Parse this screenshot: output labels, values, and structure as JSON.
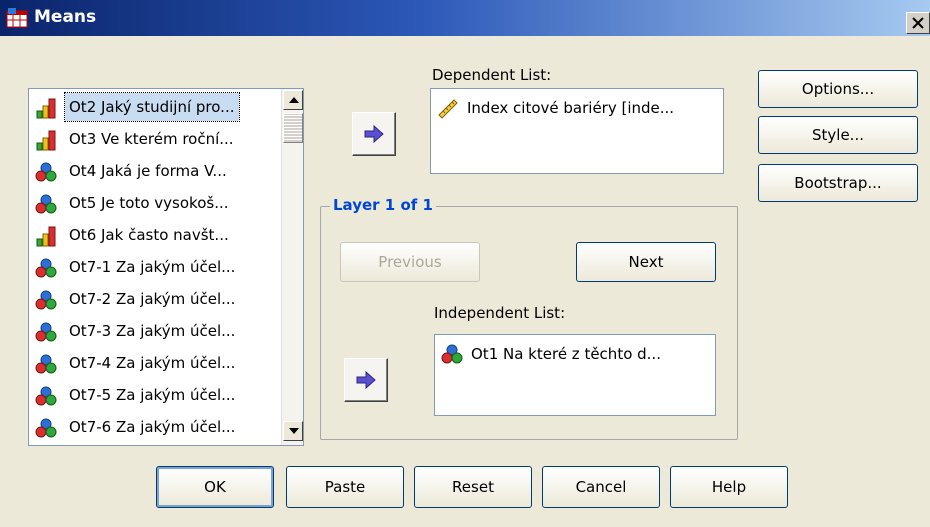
{
  "window": {
    "title": "Means"
  },
  "variables": [
    {
      "label": "Ot2 Jaký studijní pro...",
      "type": "ordinal",
      "selected": true
    },
    {
      "label": "Ot3 Ve kterém roční...",
      "type": "ordinal",
      "selected": false
    },
    {
      "label": "Ot4 Jaká je forma V...",
      "type": "nominal",
      "selected": false
    },
    {
      "label": "Ot5 Je toto vysokoš...",
      "type": "nominal",
      "selected": false
    },
    {
      "label": "Ot6 Jak často navšt...",
      "type": "ordinal",
      "selected": false
    },
    {
      "label": "Ot7-1 Za jakým účel...",
      "type": "nominal",
      "selected": false
    },
    {
      "label": "Ot7-2 Za jakým účel...",
      "type": "nominal",
      "selected": false
    },
    {
      "label": "Ot7-3 Za jakým účel...",
      "type": "nominal",
      "selected": false
    },
    {
      "label": "Ot7-4 Za jakým účel...",
      "type": "nominal",
      "selected": false
    },
    {
      "label": "Ot7-5 Za jakým účel...",
      "type": "nominal",
      "selected": false
    },
    {
      "label": "Ot7-6 Za jakým účel...",
      "type": "nominal",
      "selected": false
    }
  ],
  "dependent": {
    "label": "Dependent List:",
    "item": "Index citové bariéry [inde..."
  },
  "layer": {
    "title": "Layer 1 of 1",
    "previous": "Previous",
    "next": "Next"
  },
  "independent": {
    "label": "Independent List:",
    "item": "Ot1 Na které z těchto d..."
  },
  "side_buttons": {
    "options": "Options...",
    "style": "Style...",
    "bootstrap": "Bootstrap..."
  },
  "bottom_buttons": {
    "ok": "OK",
    "paste": "Paste",
    "reset": "Reset",
    "cancel": "Cancel",
    "help": "Help"
  },
  "colors": {
    "accent": "#0046d5",
    "selection": "#c8dcf2",
    "titlebar": "#0a246a"
  }
}
